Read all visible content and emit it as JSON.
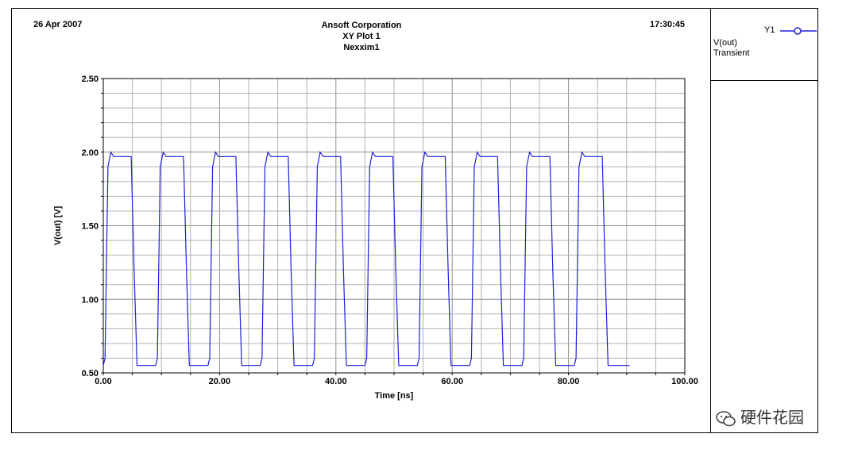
{
  "header": {
    "date": "26 Apr 2007",
    "time": "17:30:45",
    "company": "Ansoft Corporation",
    "plot_name": "XY Plot 1",
    "solver": "Nexxim1"
  },
  "legend": {
    "trace_label": "Y1",
    "quantity": "V(out)",
    "analysis": "Transient"
  },
  "watermark": {
    "text": "硬件花园"
  },
  "colors": {
    "trace": "#1f1fd6",
    "grid": "#b0b0b0",
    "axis": "#000000"
  },
  "chart_data": {
    "type": "line",
    "title": "XY Plot 1",
    "xlabel": "Time [ns]",
    "ylabel": "V(out) [V]",
    "xlim": [
      0,
      100
    ],
    "ylim": [
      0.5,
      2.5
    ],
    "x_ticks": [
      "0.00",
      "20.00",
      "40.00",
      "60.00",
      "80.00",
      "100.00"
    ],
    "y_ticks": [
      "0.50",
      "1.00",
      "1.50",
      "2.00",
      "2.50"
    ],
    "grid": true,
    "legend_placement": "right panel",
    "series": [
      {
        "name": "V(out)",
        "x": [
          0.0,
          0.3,
          0.8,
          1.3,
          1.8,
          4.8,
          5.3,
          5.8,
          9.0,
          9.3,
          9.8,
          10.3,
          10.8,
          13.8,
          14.3,
          14.8,
          18.0,
          18.3,
          18.8,
          19.3,
          19.8,
          22.8,
          23.3,
          23.8,
          27.0,
          27.3,
          27.8,
          28.3,
          28.8,
          31.8,
          32.3,
          32.8,
          36.0,
          36.3,
          36.8,
          37.3,
          37.8,
          40.8,
          41.3,
          41.8,
          45.0,
          45.3,
          45.8,
          46.3,
          46.8,
          49.8,
          50.3,
          50.8,
          54.0,
          54.3,
          54.8,
          55.3,
          55.8,
          58.8,
          59.3,
          59.8,
          63.0,
          63.3,
          63.8,
          64.3,
          64.8,
          67.8,
          68.3,
          68.8,
          72.0,
          72.3,
          72.8,
          73.3,
          73.8,
          76.8,
          77.3,
          77.8,
          81.0,
          81.3,
          81.8,
          82.3,
          82.8,
          85.8,
          86.3,
          86.8,
          90.5
        ],
        "y": [
          0.55,
          0.6,
          1.9,
          2.0,
          1.97,
          1.97,
          1.2,
          0.55,
          0.55,
          0.6,
          1.9,
          2.0,
          1.97,
          1.97,
          1.2,
          0.55,
          0.55,
          0.6,
          1.9,
          2.0,
          1.97,
          1.97,
          1.2,
          0.55,
          0.55,
          0.6,
          1.9,
          2.0,
          1.97,
          1.97,
          1.2,
          0.55,
          0.55,
          0.6,
          1.9,
          2.0,
          1.97,
          1.97,
          1.2,
          0.55,
          0.55,
          0.6,
          1.9,
          2.0,
          1.97,
          1.97,
          1.2,
          0.55,
          0.55,
          0.6,
          1.9,
          2.0,
          1.97,
          1.97,
          1.2,
          0.55,
          0.55,
          0.6,
          1.9,
          2.0,
          1.97,
          1.97,
          1.2,
          0.55,
          0.55,
          0.6,
          1.9,
          2.0,
          1.97,
          1.97,
          1.2,
          0.55,
          0.55,
          0.6,
          1.9,
          2.0,
          1.97,
          1.97,
          1.2,
          0.55,
          0.55
        ]
      }
    ]
  }
}
